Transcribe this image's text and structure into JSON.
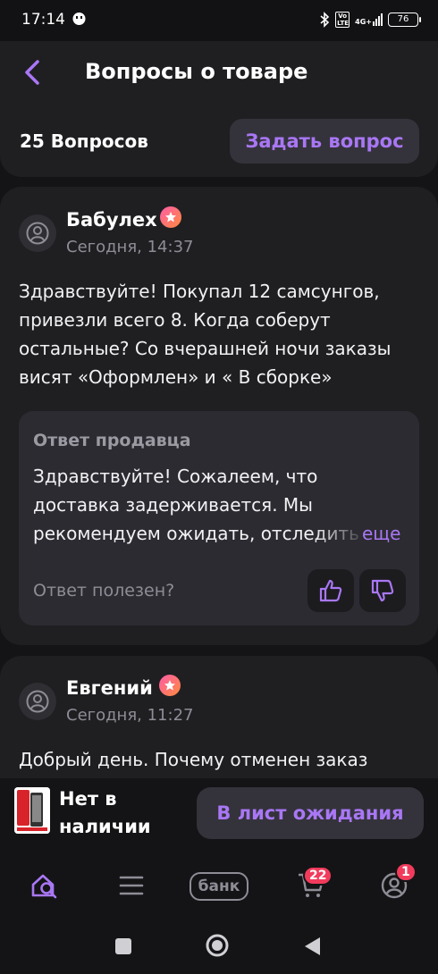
{
  "status_bar": {
    "time": "17:14",
    "network": "4G+",
    "volte": "Vo LTE",
    "battery": "76"
  },
  "header": {
    "title": "Вопросы о товаре",
    "questions_count": "25 Вопросов",
    "ask_button": "Задать вопрос"
  },
  "questions": [
    {
      "author": "Бабулех",
      "date": "Сегодня, 14:37",
      "text": "Здравствуйте! Покупал 12 самсунгов, привезли всего 8. Когда соберут остальные? Со вчерашней ночи заказы висят «Оформлен» и « В сборке»",
      "answer": {
        "label": "Ответ продавца",
        "text": "Здравствуйте! Сожалеем, что доставка задерживается. Мы рекомендуем ожидать, отследить",
        "more": "еще",
        "helpful_question": "Ответ полезен?"
      }
    },
    {
      "author": "Евгений",
      "date": "Сегодня, 11:27",
      "text": "Добрый день. Почему отменен заказ"
    }
  ],
  "buy_bar": {
    "stock_status": "Нет в наличии",
    "waitlist_button": "В лист ожидания"
  },
  "tab_bar": {
    "bank_label": "банк",
    "cart_count": "22",
    "profile_count": "1"
  },
  "colors": {
    "accent": "#a977f5",
    "badge": "#f23b5c",
    "card": "#1f1f22",
    "background": "#141416"
  }
}
